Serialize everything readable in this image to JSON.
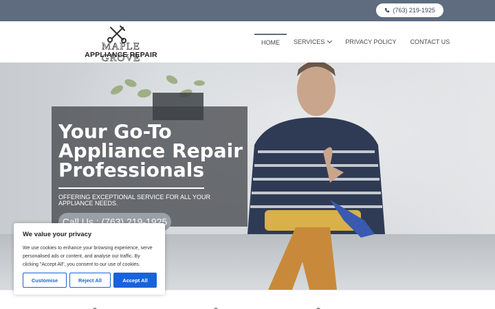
{
  "topbar": {
    "phone": "(763) 219-1925",
    "icon": "phone-icon"
  },
  "logo": {
    "line1": "MAPLE GROVE",
    "line2": "APPLIANCE REPAIR",
    "icon": "wrench-screwdriver-icon"
  },
  "nav": {
    "items": [
      {
        "label": "HOME",
        "active": true
      },
      {
        "label": "SERVICES",
        "dropdown": true
      },
      {
        "label": "PRIVACY POLICY"
      },
      {
        "label": "CONTACT US"
      }
    ]
  },
  "hero": {
    "title": "Your Go-To Appliance Repair Professionals",
    "subtitle": "OFFERING EXCEPTIONAL SERVICE FOR ALL YOUR APPLIANCE NEEDS.",
    "cta": "Call Us : (763) 219-1925"
  },
  "cookie": {
    "title": "We value your privacy",
    "text": "We use cookies to enhance your browsing experience, serve personalised ads or content, and analyse our traffic. By clicking \"Accept All\", you consent to our use of cookies.",
    "buttons": {
      "customise": "Customise",
      "reject": "Reject All",
      "accept": "Accept All"
    },
    "accent": "#1863dc"
  },
  "colors": {
    "topbar": "#5f6b7f",
    "overlay": "#3c3e42"
  }
}
